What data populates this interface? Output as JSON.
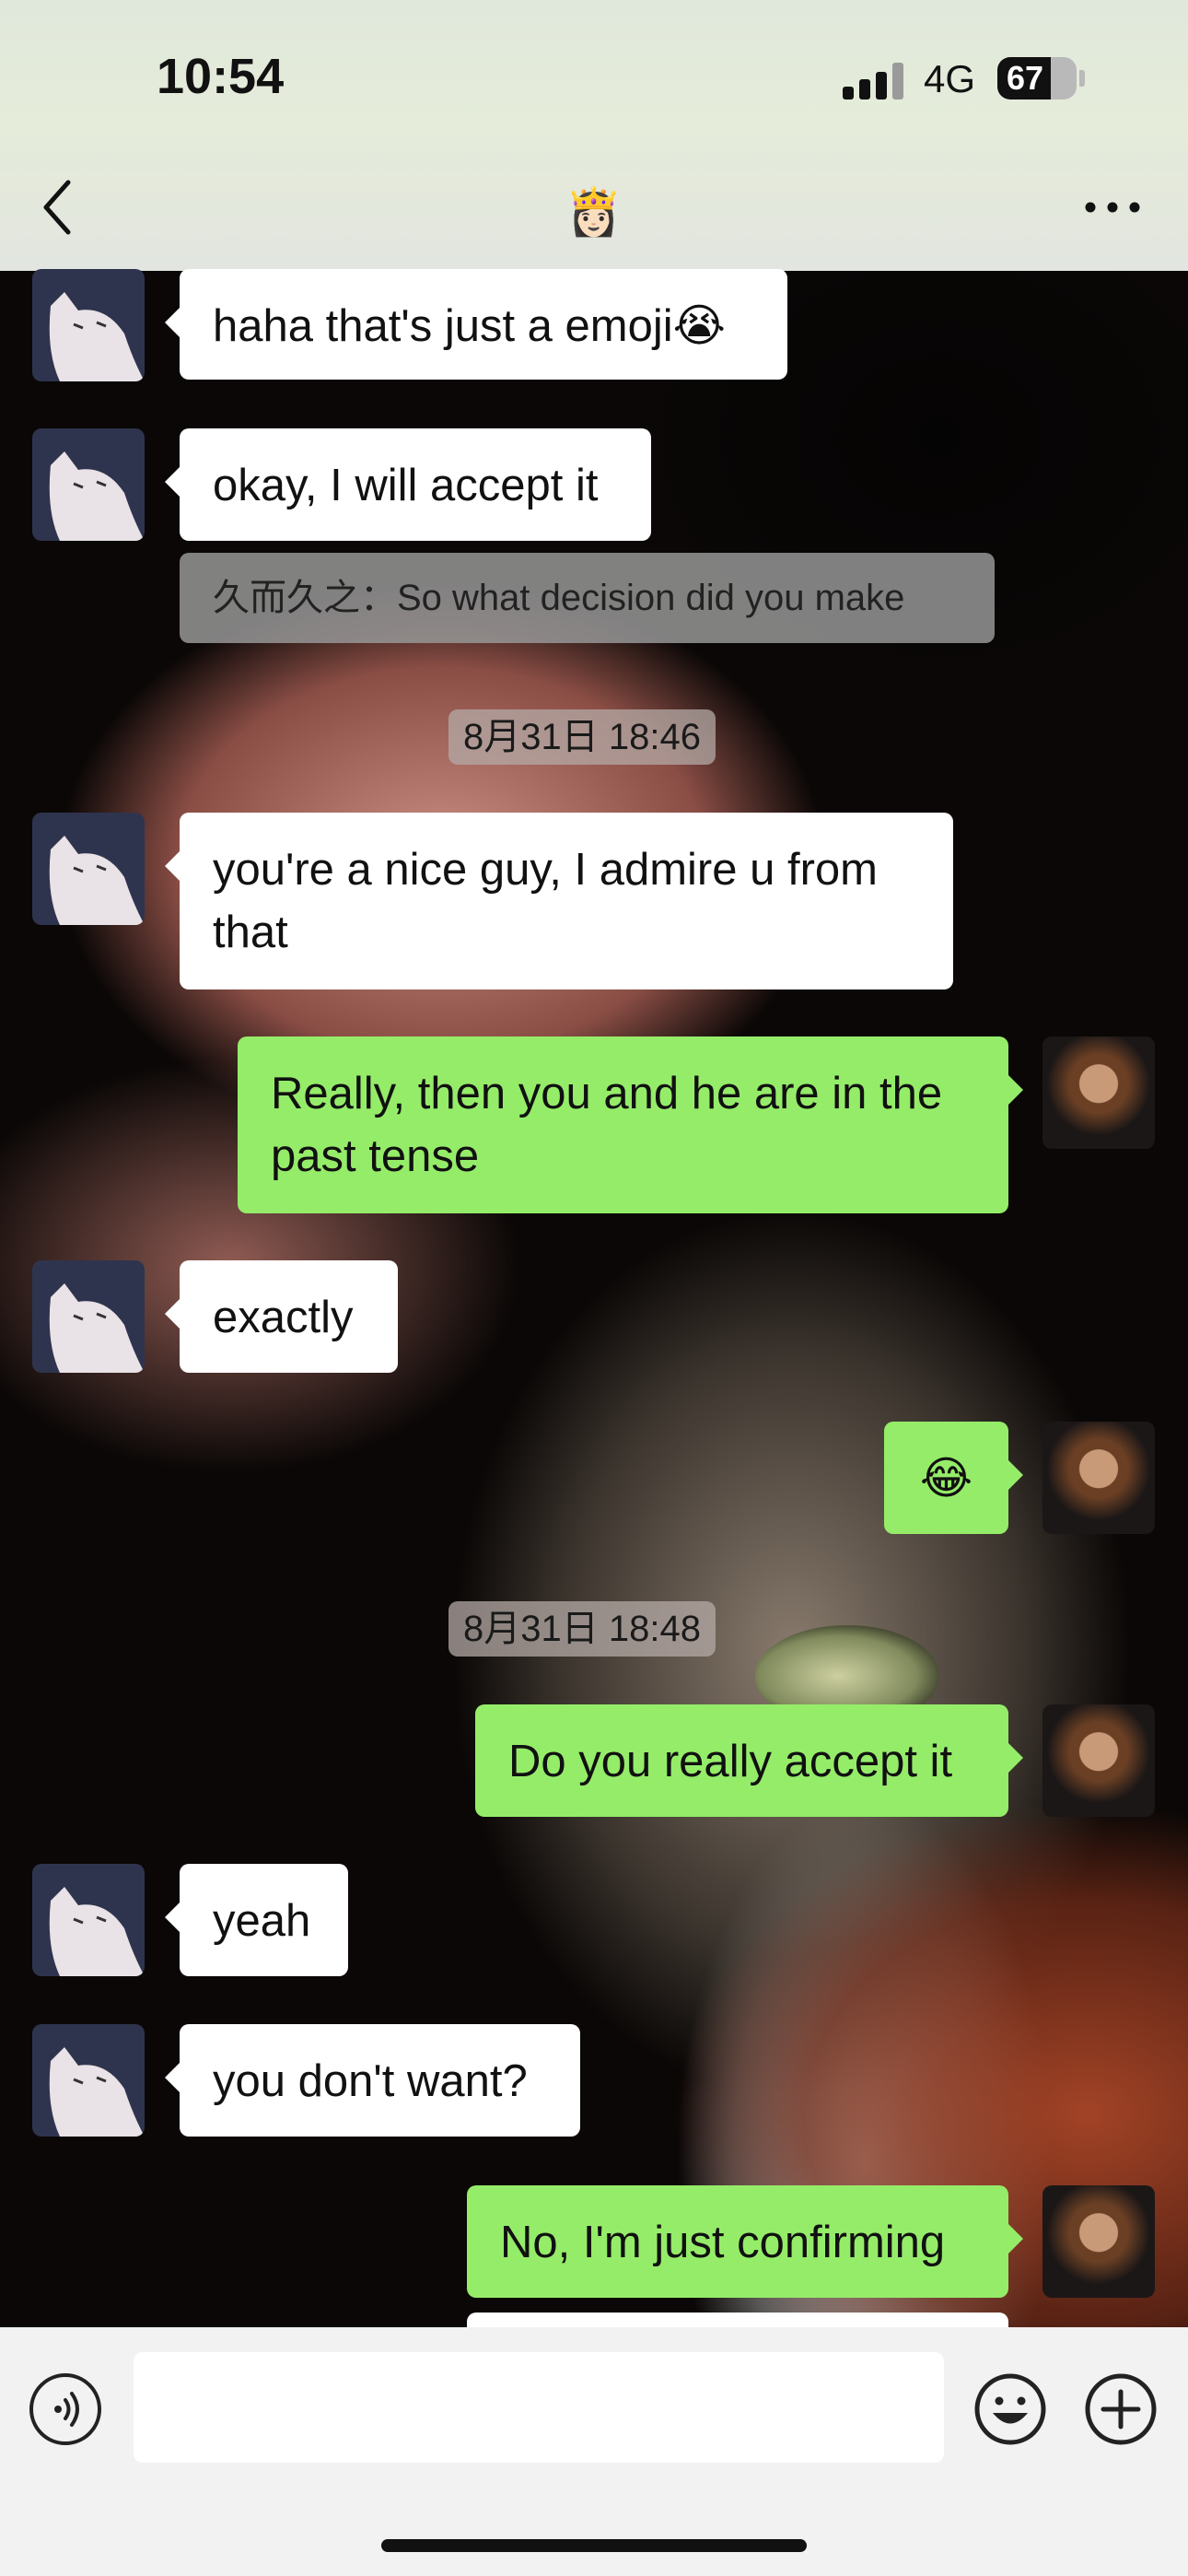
{
  "status_bar": {
    "time": "10:54",
    "network": "4G",
    "battery_percent": "67",
    "battery_level": 0.67
  },
  "nav": {
    "title": "👸🏻"
  },
  "messages": [
    {
      "side": "in",
      "text": "haha that's just a emoji😭"
    },
    {
      "side": "in",
      "text": "okay, I will accept it",
      "quote": "久而久之：So what decision did you make"
    },
    {
      "type": "timestamp",
      "text": "8月31日 18:46"
    },
    {
      "side": "in",
      "text": "you're a nice guy, I admire u from that"
    },
    {
      "side": "out",
      "text": "Really, then you and he are in the past tense"
    },
    {
      "side": "in",
      "text": "exactly"
    },
    {
      "side": "out",
      "text": "😂"
    },
    {
      "type": "timestamp",
      "text": "8月31日 18:48"
    },
    {
      "side": "out",
      "text": "Do you really accept it"
    },
    {
      "side": "in",
      "text": "yeah"
    },
    {
      "side": "in",
      "text": "you don't want?"
    },
    {
      "side": "out",
      "text": "No, I'm just confirming"
    }
  ],
  "input": {
    "value": "",
    "placeholder": ""
  },
  "icons": {
    "back": "chevron-left-icon",
    "more": "more-dots-icon",
    "voice": "voice-icon",
    "emoji": "emoji-icon",
    "plus": "plus-icon"
  }
}
